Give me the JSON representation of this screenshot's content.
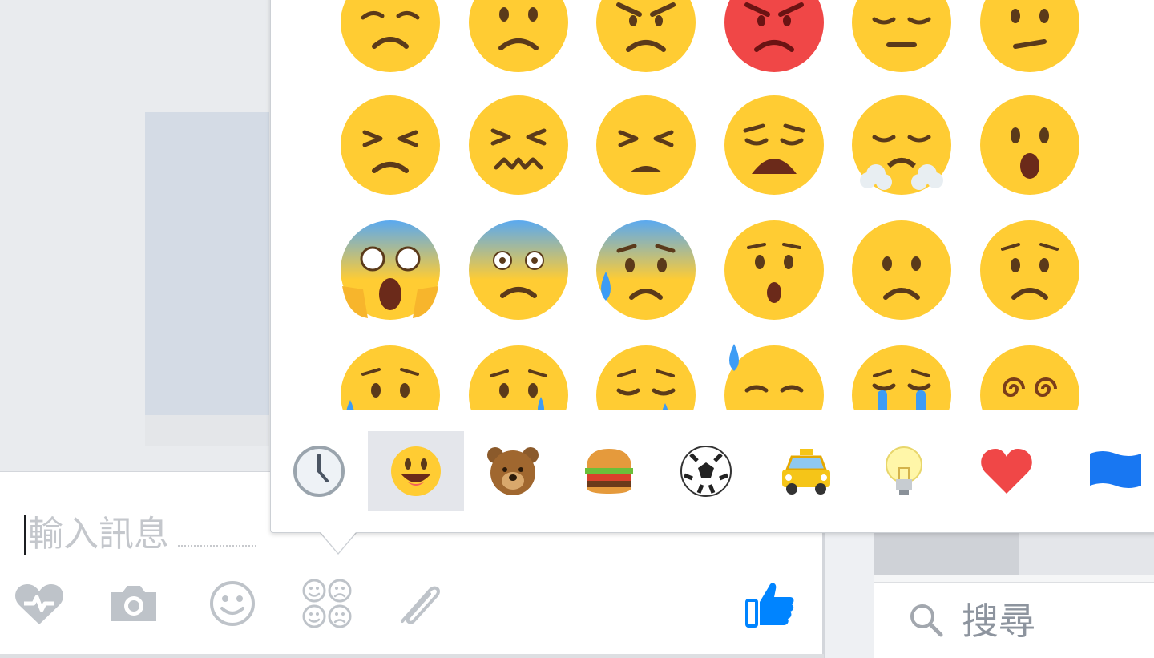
{
  "composer": {
    "placeholder": "輸入訊息",
    "tools": [
      {
        "name": "heart-bolt-icon",
        "color": "#bec3c9"
      },
      {
        "name": "camera-icon",
        "color": "#bec3c9"
      },
      {
        "name": "smiley-icon",
        "color": "#bec3c9"
      },
      {
        "name": "stickers-icon",
        "color": "#bec3c9"
      },
      {
        "name": "paperclip-icon",
        "color": "#bec3c9"
      }
    ],
    "like_icon": "thumbs-up-icon",
    "accent": "#0084ff"
  },
  "search": {
    "placeholder": "搜尋"
  },
  "emoji_picker": {
    "rows": [
      [
        "persevering-face",
        "frowning-face",
        "angry-face",
        "pouting-face",
        "pensive-face",
        "confused-face"
      ],
      [
        "tired-face",
        "confounded-face",
        "persevering-closed-face",
        "weary-face",
        "triumph-face",
        "open-mouth-face"
      ],
      [
        "screaming-face",
        "fearful-face",
        "anxious-sweat-face",
        "hushed-face",
        "sad-face",
        "worried-face"
      ],
      [
        "sad-sweat-face",
        "crying-face",
        "sleepy-face",
        "downcast-sweat-face",
        "loudly-crying-face",
        "dizzy-face"
      ]
    ],
    "categories": [
      {
        "name": "recent-clock-icon",
        "active": false
      },
      {
        "name": "smileys-category-icon",
        "active": true
      },
      {
        "name": "animals-bear-icon",
        "active": false
      },
      {
        "name": "food-burger-icon",
        "active": false
      },
      {
        "name": "activity-soccer-icon",
        "active": false
      },
      {
        "name": "travel-taxi-icon",
        "active": false
      },
      {
        "name": "objects-bulb-icon",
        "active": false
      },
      {
        "name": "symbols-heart-icon",
        "active": false
      },
      {
        "name": "flags-flag-icon",
        "active": false
      }
    ],
    "colors": {
      "face": "#ffcc33",
      "angry": "#f04747",
      "tears": "#3d9cf5"
    }
  }
}
